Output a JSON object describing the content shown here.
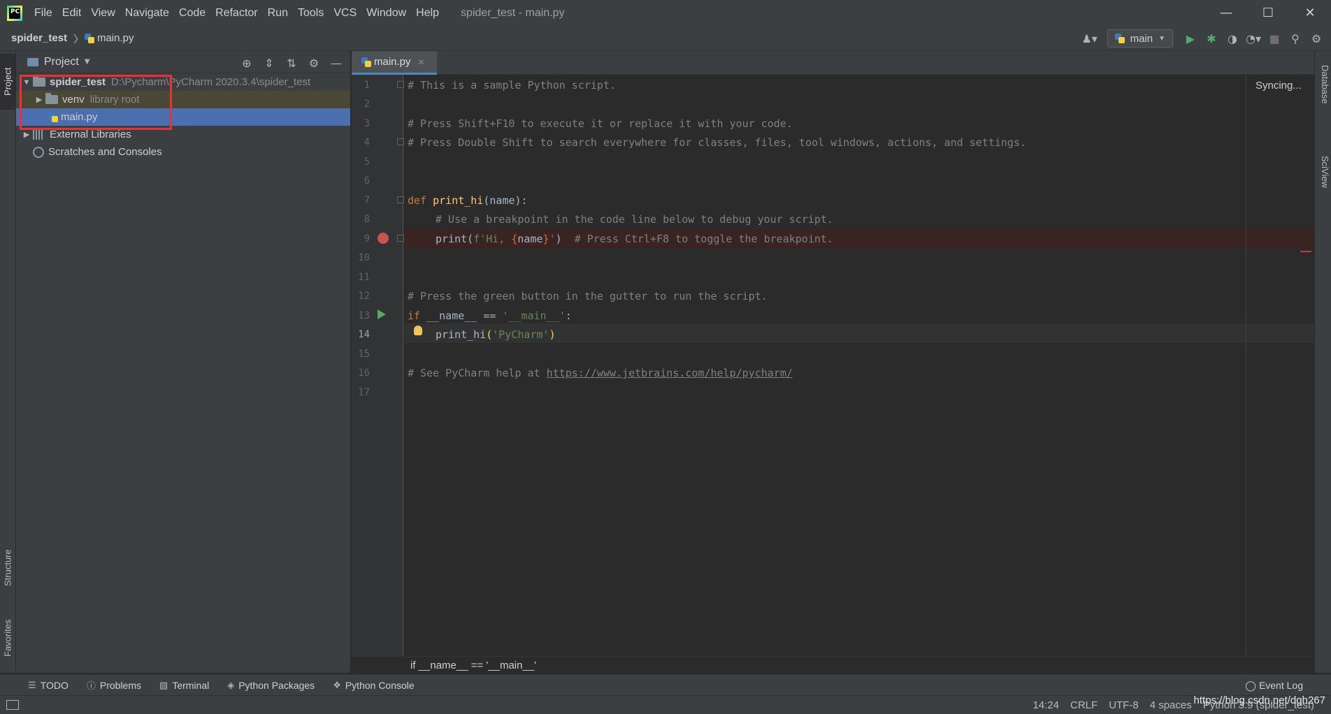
{
  "window": {
    "title": "spider_test - main.py",
    "logo_text": "PC"
  },
  "menu": [
    "File",
    "Edit",
    "View",
    "Navigate",
    "Code",
    "Refactor",
    "Run",
    "Tools",
    "VCS",
    "Window",
    "Help"
  ],
  "navbar": {
    "project": "spider_test",
    "file": "main.py",
    "run_config": "main"
  },
  "left_stripe": {
    "project": "Project",
    "structure": "Structure",
    "favorites": "Favorites"
  },
  "project_panel": {
    "title": "Project",
    "tree": {
      "root_name": "spider_test",
      "root_path": "D:\\Pycharm\\PyCharm 2020.3.4\\spider_test",
      "venv_name": "venv",
      "venv_note": "library root",
      "file_name": "main.py",
      "external": "External Libraries",
      "scratches": "Scratches and Consoles"
    }
  },
  "editor": {
    "tab": "main.py",
    "status": "Syncing...",
    "line_numbers": [
      "1",
      "2",
      "3",
      "4",
      "5",
      "6",
      "7",
      "8",
      "9",
      "10",
      "11",
      "12",
      "13",
      "14",
      "15",
      "16",
      "17"
    ],
    "current_line": "14",
    "code": {
      "l1": "# This is a sample Python script.",
      "l3": "# Press Shift+F10 to execute it or replace it with your code.",
      "l4": "# Press Double Shift to search everywhere for classes, files, tool windows, actions, and settings.",
      "l7_kw": "def",
      "l7_fn": "print_hi",
      "l7_rest": "(name):",
      "l8": "# Use a breakpoint in the code line below to debug your script.",
      "l9_a": "print(",
      "l9_str1": "f'Hi, ",
      "l9_b1": "{",
      "l9_var": "name",
      "l9_b2": "}",
      "l9_str2": "'",
      "l9_c": ")",
      "l9_comment": "# Press Ctrl+F8 to toggle the breakpoint.",
      "l12": "# Press the green button in the gutter to run the script.",
      "l13_kw": "if",
      "l13_mid": " __name__ == ",
      "l13_str": "'__main__'",
      "l13_end": ":",
      "l14_a": "print_hi",
      "l14_p1": "(",
      "l14_str": "'PyCharm'",
      "l14_p2": ")",
      "l16_a": "# See PyCharm help at ",
      "l16_link": "https://www.jetbrains.com/help/pycharm/"
    },
    "code_breadcrumb": "if __name__ == '__main__'"
  },
  "right_stripe": {
    "database": "Database",
    "sciview": "SciView"
  },
  "tool_windows": [
    "TODO",
    "Problems",
    "Terminal",
    "Python Packages",
    "Python Console"
  ],
  "event_log": "Event Log",
  "status": {
    "position": "14:24",
    "line_sep": "CRLF",
    "encoding": "UTF-8",
    "indent": "4 spaces",
    "interpreter": "Python 3.9 (spider_test)"
  },
  "watermark": "https://blog.csdn.net/dgh267"
}
